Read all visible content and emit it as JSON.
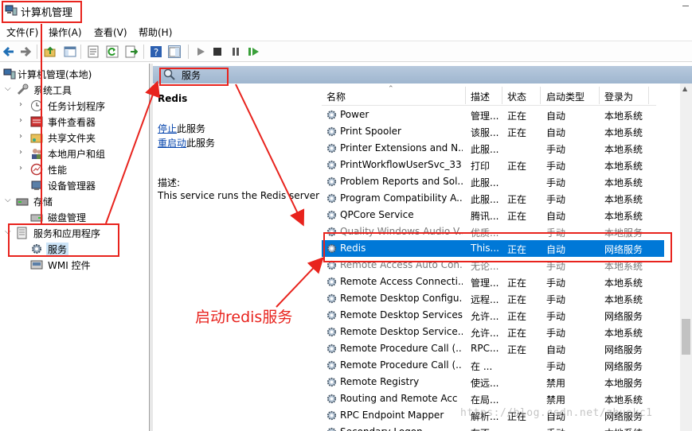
{
  "window": {
    "title": "计算机管理"
  },
  "menu": [
    "文件(F)",
    "操作(A)",
    "查看(V)",
    "帮助(H)"
  ],
  "tree": {
    "root": "计算机管理(本地)",
    "system_tools": "系统工具",
    "task_scheduler": "任务计划程序",
    "event_viewer": "事件查看器",
    "shared_folders": "共享文件夹",
    "local_users": "本地用户和组",
    "performance": "性能",
    "device_manager": "设备管理器",
    "storage": "存储",
    "disk_mgmt": "磁盘管理",
    "services_apps": "服务和应用程序",
    "services": "服务",
    "wmi": "WMI 控件"
  },
  "pane": {
    "header": "服务",
    "selected_name": "Redis",
    "stop_link": "停止",
    "stop_rest": "此服务",
    "restart_link": "重启动",
    "restart_rest": "此服务",
    "desc_label": "描述:",
    "desc_text": "This service runs the Redis server"
  },
  "columns": {
    "name": "名称",
    "desc": "描述",
    "status": "状态",
    "startup": "启动类型",
    "logon": "登录为"
  },
  "services": [
    {
      "name": "Power",
      "desc": "管理...",
      "status": "正在",
      "startup": "自动",
      "logon": "本地系统"
    },
    {
      "name": "Print Spooler",
      "desc": "该服...",
      "status": "正在",
      "startup": "自动",
      "logon": "本地系统"
    },
    {
      "name": "Printer Extensions and N...",
      "desc": "此服...",
      "status": "",
      "startup": "手动",
      "logon": "本地系统"
    },
    {
      "name": "PrintWorkflowUserSvc_33",
      "desc": "打印",
      "status": "正在",
      "startup": "手动",
      "logon": "本地系统"
    },
    {
      "name": "Problem Reports and Sol...",
      "desc": "此服...",
      "status": "",
      "startup": "手动",
      "logon": "本地系统"
    },
    {
      "name": "Program Compatibility A...",
      "desc": "此服...",
      "status": "正在",
      "startup": "手动",
      "logon": "本地系统"
    },
    {
      "name": "QPCore Service",
      "desc": "腾讯...",
      "status": "正在",
      "startup": "自动",
      "logon": "本地系统"
    },
    {
      "name": "Quality Windows Audio V...",
      "desc": "优质...",
      "status": "",
      "startup": "手动",
      "logon": "本地服务"
    },
    {
      "name": "Redis",
      "desc": "This...",
      "status": "正在",
      "startup": "自动",
      "logon": "网络服务"
    },
    {
      "name": "Remote Access Auto Con...",
      "desc": "无论...",
      "status": "",
      "startup": "手动",
      "logon": "本地系统"
    },
    {
      "name": "Remote Access Connecti...",
      "desc": "管理...",
      "status": "正在",
      "startup": "手动",
      "logon": "本地系统"
    },
    {
      "name": "Remote Desktop Configu...",
      "desc": "远程...",
      "status": "正在",
      "startup": "手动",
      "logon": "本地系统"
    },
    {
      "name": "Remote Desktop Services",
      "desc": "允许...",
      "status": "正在",
      "startup": "手动",
      "logon": "网络服务"
    },
    {
      "name": "Remote Desktop Service...",
      "desc": "允许...",
      "status": "正在",
      "startup": "手动",
      "logon": "本地系统"
    },
    {
      "name": "Remote Procedure Call (...",
      "desc": "RPC...",
      "status": "正在",
      "startup": "自动",
      "logon": "网络服务"
    },
    {
      "name": "Remote Procedure Call (...",
      "desc": "在 ...",
      "status": "",
      "startup": "手动",
      "logon": "网络服务"
    },
    {
      "name": "Remote Registry",
      "desc": "使远...",
      "status": "",
      "startup": "禁用",
      "logon": "本地服务"
    },
    {
      "name": "Routing and Remote Acc",
      "desc": "在局...",
      "status": "",
      "startup": "禁用",
      "logon": "本地系统"
    },
    {
      "name": "RPC Endpoint Mapper",
      "desc": "解析...",
      "status": "正在",
      "startup": "自动",
      "logon": "网络服务"
    },
    {
      "name": "Secondary Logon",
      "desc": "在不...",
      "status": "",
      "startup": "手动",
      "logon": "本地系统"
    }
  ],
  "annotation": "启动redis服务",
  "watermark": "https://blog.csdn.net/zhuokc1",
  "colors": {
    "annotation": "#e8231d",
    "selection": "#0078d7",
    "header": "#a9bed6"
  }
}
